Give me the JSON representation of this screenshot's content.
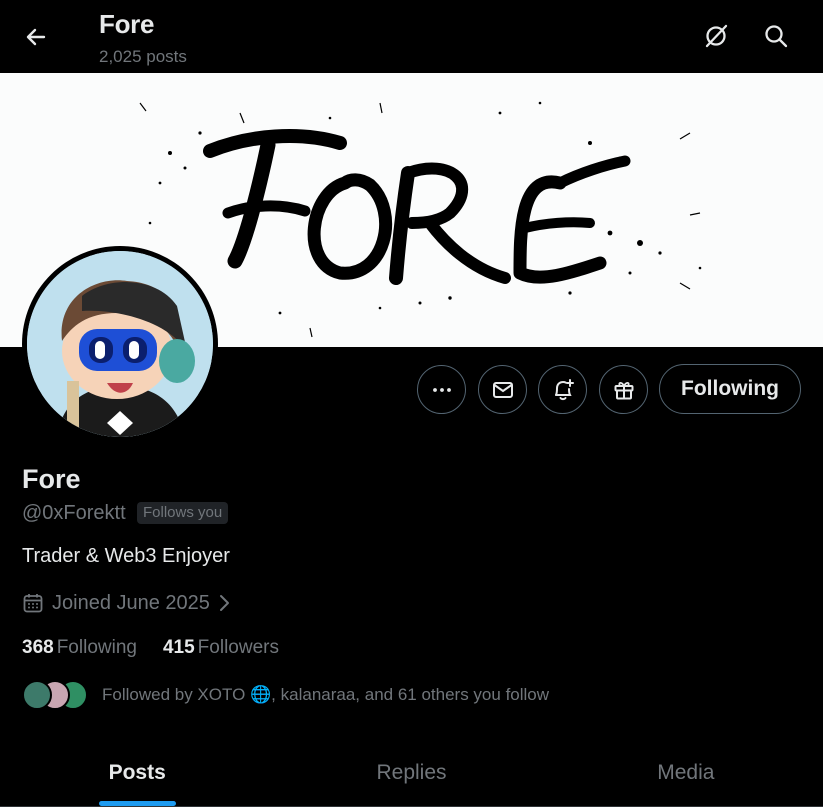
{
  "header": {
    "title": "Fore",
    "post_count": "2,025 posts"
  },
  "banner": {
    "wordmark": "FORE"
  },
  "profile": {
    "display_name": "Fore",
    "handle": "@0xForektt",
    "follows_you_badge": "Follows you",
    "bio": "Trader & Web3 Enjoyer",
    "joined": "Joined June 2025"
  },
  "actions": {
    "following_label": "Following"
  },
  "stats": {
    "following_count": "368",
    "following_label": "Following",
    "followers_count": "415",
    "followers_label": "Followers"
  },
  "followed_by": {
    "text": "Followed by XOTO 🌐, kalanaraa, and 61 others you follow"
  },
  "tabs": [
    {
      "label": "Posts",
      "active": true
    },
    {
      "label": "Replies",
      "active": false
    },
    {
      "label": "Media",
      "active": false
    }
  ],
  "colors": {
    "accent": "#1d9bf0",
    "background": "#000000",
    "text_primary": "#e7e9ea",
    "text_secondary": "#71767b"
  }
}
